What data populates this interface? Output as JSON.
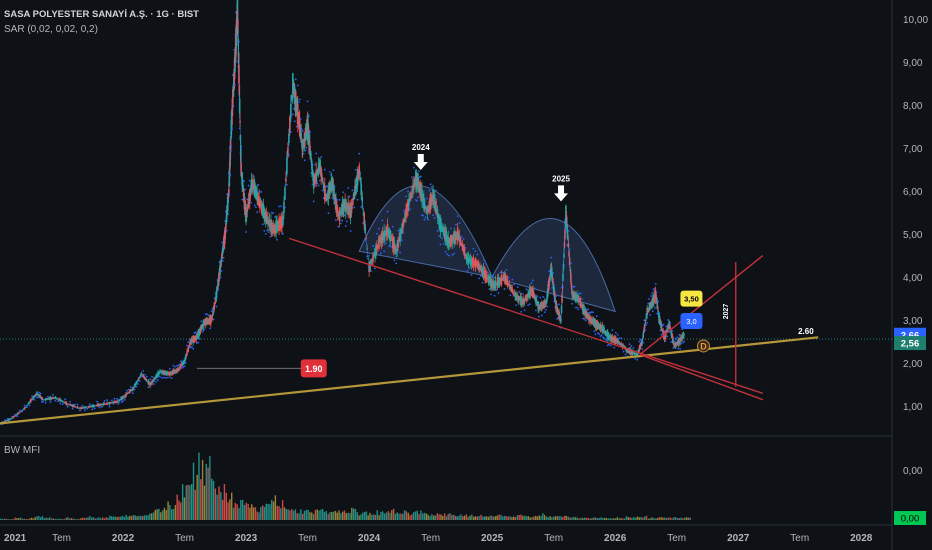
{
  "header": {
    "title": "SASA POLYESTER SANAYİ A.Ş. · 1G · BIST",
    "indicator": "SAR (0,02, 0,02, 0,2)",
    "lower_indicator": "BW MFI"
  },
  "colors": {
    "background": "#0e1217",
    "up": "#26a69a",
    "down": "#ef5350",
    "sar": "#2962ff",
    "trendline": "#b5973a",
    "wedge": "#c2303a",
    "dome_fill": "#2a3b5c"
  },
  "chart_data": {
    "type": "line",
    "title": "SASA POLYESTER SANAYİ A.Ş. · 1G · BIST",
    "x_axis": {
      "labels": [
        "2021",
        "Tem",
        "2022",
        "Tem",
        "2023",
        "Tem",
        "2024",
        "Tem",
        "2025",
        "Tem",
        "2026",
        "Tem",
        "2027",
        "Tem",
        "2028"
      ],
      "range": [
        2021.0,
        2028.25
      ]
    },
    "y_axis": {
      "ticks": [
        "1,00",
        "2,00",
        "3,00",
        "4,00",
        "5,00",
        "6,00",
        "7,00",
        "8,00",
        "9,00",
        "10,00"
      ],
      "range": [
        0.4,
        10.3
      ]
    },
    "lower_axis": {
      "ticks": [
        "0,00",
        "0,00"
      ]
    },
    "price_labels": [
      "2,66",
      "2,56"
    ],
    "lower_last_value": "0,00",
    "series": [
      {
        "key": "price",
        "x": [
          2021.0,
          2021.1,
          2021.2,
          2021.3,
          2021.35,
          2021.45,
          2021.55,
          2021.65,
          2021.75,
          2021.85,
          2021.95,
          2022.0,
          2022.08,
          2022.15,
          2022.22,
          2022.3,
          2022.38,
          2022.45,
          2022.5,
          2022.55,
          2022.6,
          2022.66,
          2022.72,
          2022.76,
          2022.8,
          2022.83,
          2022.86,
          2022.88,
          2022.91,
          2022.93,
          2022.96,
          2023.0,
          2023.05,
          2023.1,
          2023.16,
          2023.22,
          2023.3,
          2023.38,
          2023.42,
          2023.46,
          2023.5,
          2023.55,
          2023.6,
          2023.65,
          2023.7,
          2023.75,
          2023.8,
          2023.85,
          2023.92,
          2024.0,
          2024.08,
          2024.15,
          2024.22,
          2024.3,
          2024.38,
          2024.42,
          2024.47,
          2024.52,
          2024.58,
          2024.65,
          2024.72,
          2024.8,
          2024.88,
          2024.95,
          2025.02,
          2025.1,
          2025.18,
          2025.25,
          2025.32,
          2025.38,
          2025.44,
          2025.48,
          2025.52,
          2025.56,
          2025.6,
          2025.65,
          2025.7,
          2025.75,
          2025.8,
          2025.85,
          2025.9,
          2025.95,
          2026.02,
          2026.1,
          2026.18,
          2026.22,
          2026.26,
          2026.3,
          2026.33,
          2026.36,
          2026.4,
          2026.44,
          2026.48,
          2026.52,
          2026.56
        ],
        "y": [
          0.6,
          0.72,
          0.95,
          1.3,
          1.15,
          1.2,
          1.05,
          0.95,
          1.0,
          1.05,
          1.1,
          1.2,
          1.4,
          1.75,
          1.5,
          1.8,
          1.75,
          1.85,
          2.05,
          2.5,
          2.6,
          2.95,
          3.0,
          3.6,
          4.4,
          5.0,
          6.0,
          7.5,
          9.0,
          10.2,
          6.5,
          5.4,
          6.2,
          5.8,
          5.4,
          5.1,
          5.3,
          8.5,
          7.8,
          7.0,
          7.5,
          6.2,
          6.6,
          5.8,
          6.2,
          5.4,
          5.7,
          5.5,
          6.5,
          4.2,
          4.8,
          5.1,
          4.6,
          5.5,
          6.3,
          6.0,
          5.5,
          5.9,
          5.2,
          4.8,
          5.0,
          4.4,
          4.3,
          4.0,
          3.8,
          4.0,
          3.6,
          3.4,
          3.7,
          3.3,
          3.4,
          4.2,
          3.3,
          3.0,
          5.5,
          3.6,
          3.5,
          3.2,
          3.0,
          2.9,
          2.8,
          2.6,
          2.5,
          2.3,
          2.2,
          2.5,
          3.2,
          3.4,
          3.6,
          3.0,
          2.6,
          2.9,
          2.4,
          2.5,
          2.66
        ]
      }
    ],
    "volume": [
      1,
      1,
      2,
      1,
      2,
      3,
      2,
      1,
      1,
      2,
      1,
      2,
      3,
      2,
      2,
      3,
      3,
      4,
      4,
      5,
      6,
      8,
      10,
      14,
      20,
      28,
      40,
      50,
      45,
      35,
      25,
      20,
      16,
      14,
      12,
      10,
      12,
      18,
      14,
      10,
      9,
      8,
      9,
      8,
      9,
      7,
      8,
      7,
      9,
      6,
      6,
      7,
      6,
      7,
      8,
      7,
      6,
      7,
      6,
      5,
      5,
      5,
      5,
      4,
      4,
      4,
      4,
      3,
      4,
      3,
      3,
      4,
      3,
      3,
      5,
      3,
      3,
      3,
      3,
      2,
      2,
      2,
      2,
      2,
      2,
      2,
      3,
      3,
      3,
      2,
      2,
      2,
      2,
      2,
      2
    ],
    "annotations": [
      {
        "text": "2024",
        "x": 2024.42,
        "y": 6.35,
        "kind": "down-arrow"
      },
      {
        "text": "2025",
        "x": 2025.56,
        "y": 5.62,
        "kind": "down-arrow"
      },
      {
        "text": "1.90",
        "x": 2023.55,
        "y": 1.88,
        "kind": "red-box"
      },
      {
        "text": "3,50",
        "x": 2026.62,
        "y": 3.5,
        "kind": "yellow-box"
      },
      {
        "text": "3,0",
        "x": 2026.62,
        "y": 2.98,
        "kind": "blue-box"
      },
      {
        "text": "D",
        "x": 2026.62,
        "y": 2.4,
        "kind": "circle"
      },
      {
        "text": "2027",
        "x": 2026.95,
        "y": 3.2,
        "kind": "vertical-text"
      },
      {
        "text": "2.60",
        "x": 2027.55,
        "y": 2.68,
        "kind": "plain"
      }
    ],
    "lines": [
      {
        "kind": "support",
        "x": [
          2021.0,
          2027.65
        ],
        "y": [
          0.6,
          2.6
        ]
      },
      {
        "kind": "wedge-upper",
        "x": [
          2023.35,
          2027.2
        ],
        "y": [
          4.9,
          1.3
        ]
      },
      {
        "kind": "wedge-lower",
        "x": [
          2026.2,
          2027.2
        ],
        "y": [
          2.2,
          4.5
        ]
      },
      {
        "kind": "wedge-bottom",
        "x": [
          2026.2,
          2027.2
        ],
        "y": [
          2.2,
          1.15
        ]
      },
      {
        "kind": "target",
        "x": [
          2026.98,
          2026.98
        ],
        "y": [
          4.35,
          1.45
        ]
      }
    ],
    "domes": [
      {
        "x": [
          2023.92,
          2024.42,
          2025.0
        ],
        "y": [
          4.6,
          6.35,
          4.0
        ]
      },
      {
        "x": [
          2025.0,
          2025.56,
          2026.0
        ],
        "y": [
          4.0,
          5.62,
          3.2
        ]
      }
    ],
    "horizontal_refs": [
      {
        "value": 2.56,
        "style": "dotted"
      },
      {
        "value": 1.88,
        "style": "solid",
        "x": [
          2022.6,
          2023.45
        ]
      }
    ]
  }
}
